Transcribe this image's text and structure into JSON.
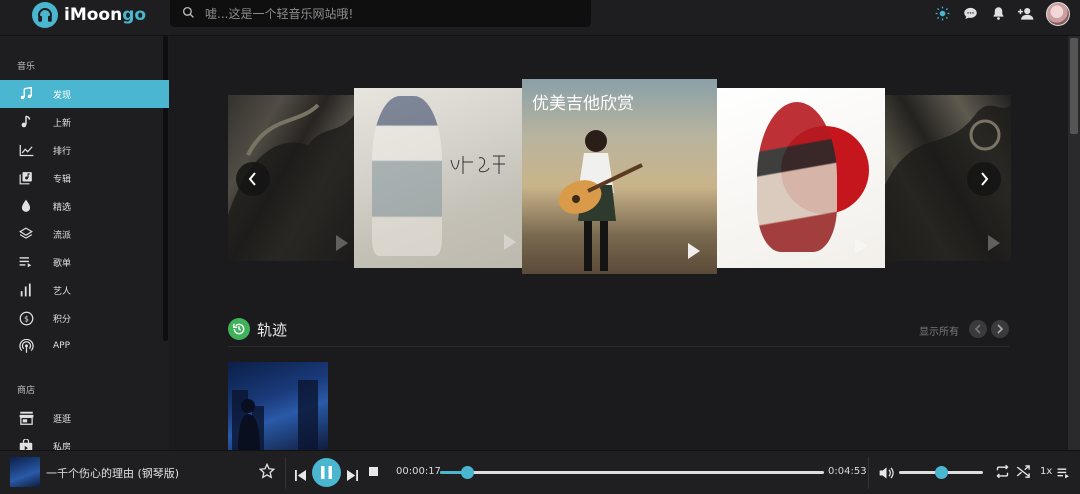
{
  "app": {
    "logo_prefix": "i",
    "logo_main": "Moon",
    "logo_accent": "go"
  },
  "search": {
    "placeholder": "嘘...这是一个轻音乐网站哦!"
  },
  "top_icons": [
    "theme-icon",
    "chat-icon",
    "bell-icon",
    "add-user-icon"
  ],
  "sidebar": {
    "music_label": "音乐",
    "music_items": [
      {
        "label": "发现",
        "icon": "music-note-icon",
        "active": true
      },
      {
        "label": "上新",
        "icon": "single-note-icon",
        "active": false
      },
      {
        "label": "排行",
        "icon": "chart-line-icon",
        "active": false
      },
      {
        "label": "专辑",
        "icon": "album-icon",
        "active": false
      },
      {
        "label": "精选",
        "icon": "drop-icon",
        "active": false
      },
      {
        "label": "流派",
        "icon": "layers-icon",
        "active": false
      },
      {
        "label": "歌单",
        "icon": "playlist-icon",
        "active": false
      },
      {
        "label": "艺人",
        "icon": "bars-icon",
        "active": false
      },
      {
        "label": "积分",
        "icon": "coin-icon",
        "active": false
      },
      {
        "label": "APP",
        "icon": "broadcast-icon",
        "active": false
      }
    ],
    "store_label": "商店",
    "store_items": [
      {
        "label": "逛逛",
        "icon": "store-icon"
      },
      {
        "label": "私房",
        "icon": "bag-icon"
      }
    ]
  },
  "carousel": {
    "center_title": "优美吉他欣赏"
  },
  "section": {
    "title": "轨迹",
    "show_all": "显示所有"
  },
  "player": {
    "track_title": "一千个伤心的理由 (钢琴版)",
    "current_time": "00:00:17",
    "total_time": "0:04:53",
    "progress": 0.07,
    "volume": 0.5,
    "speed": "1x",
    "accent_color": "#4ab6cf"
  }
}
